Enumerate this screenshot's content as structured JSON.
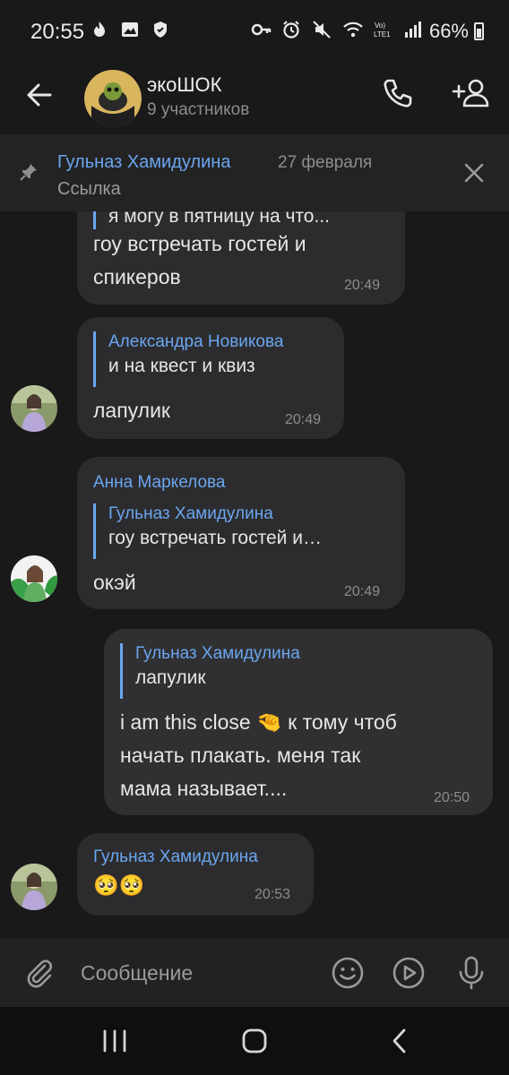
{
  "status_bar": {
    "time": "20:55",
    "battery": "66%"
  },
  "header": {
    "title": "экоШОК",
    "subtitle": "9 участников"
  },
  "pinned": {
    "author": "Гульназ Хамидулина",
    "date": "27 февраля",
    "text": "Ссылка"
  },
  "messages": [
    {
      "partial_line": "я могу в пятницу на что...",
      "lines": [
        "гоу встречать гостей и",
        "спикеров"
      ],
      "time": "20:49"
    },
    {
      "reply_author": "Александра Новикова",
      "reply_text": "и на квест и квиз",
      "lines": [
        "лапулик"
      ],
      "time": "20:49"
    },
    {
      "author": "Анна Маркелова",
      "reply_author": "Гульназ Хамидулина",
      "reply_text": "гоу встречать гостей и…",
      "lines": [
        "окэй"
      ],
      "time": "20:49"
    },
    {
      "reply_author": "Гульназ Хамидулина",
      "reply_text": "лапулик",
      "lines": [
        "i am this close 🤏 к тому чтоб",
        "начать плакать. меня так",
        "мама называет...."
      ],
      "time": "20:50"
    },
    {
      "author": "Гульназ Хамидулина",
      "lines": [
        "🥺🥺"
      ],
      "time": "20:53"
    }
  ],
  "input": {
    "placeholder": "Сообщение"
  },
  "colors": {
    "background": "#19191a",
    "bubble": "#2c2c2e",
    "accent": "#6aa6f0"
  }
}
